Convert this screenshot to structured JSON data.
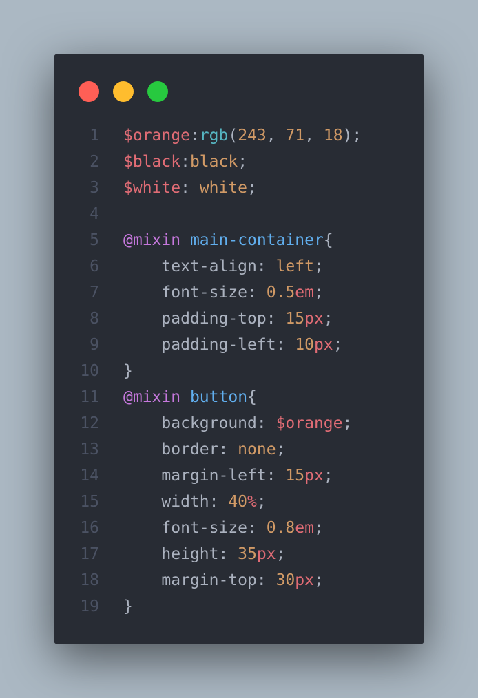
{
  "window": {
    "controls": [
      {
        "name": "close",
        "color": "#ff5f56"
      },
      {
        "name": "minimize",
        "color": "#ffbd2e"
      },
      {
        "name": "maximize",
        "color": "#27c93f"
      }
    ]
  },
  "code": {
    "language": "scss",
    "lines": [
      {
        "number": "1",
        "tokens": [
          {
            "text": "$orange",
            "type": "var"
          },
          {
            "text": ":",
            "type": "p"
          },
          {
            "text": "rgb",
            "type": "fn"
          },
          {
            "text": "(",
            "type": "p"
          },
          {
            "text": "243",
            "type": "num"
          },
          {
            "text": ", ",
            "type": "p"
          },
          {
            "text": "71",
            "type": "num"
          },
          {
            "text": ", ",
            "type": "p"
          },
          {
            "text": "18",
            "type": "num"
          },
          {
            "text": ");",
            "type": "p"
          }
        ]
      },
      {
        "number": "2",
        "tokens": [
          {
            "text": "$black",
            "type": "var"
          },
          {
            "text": ":",
            "type": "p"
          },
          {
            "text": "black",
            "type": "num"
          },
          {
            "text": ";",
            "type": "p"
          }
        ]
      },
      {
        "number": "3",
        "tokens": [
          {
            "text": "$white",
            "type": "var"
          },
          {
            "text": ": ",
            "type": "p"
          },
          {
            "text": "white",
            "type": "num"
          },
          {
            "text": ";",
            "type": "p"
          }
        ]
      },
      {
        "number": "4",
        "tokens": []
      },
      {
        "number": "5",
        "tokens": [
          {
            "text": "@mixin",
            "type": "kw"
          },
          {
            "text": " ",
            "type": "p"
          },
          {
            "text": "main-container",
            "type": "name"
          },
          {
            "text": "{",
            "type": "p"
          }
        ]
      },
      {
        "number": "6",
        "tokens": [
          {
            "text": "    text-align: ",
            "type": "p"
          },
          {
            "text": "left",
            "type": "num"
          },
          {
            "text": ";",
            "type": "p"
          }
        ]
      },
      {
        "number": "7",
        "tokens": [
          {
            "text": "    font-size: ",
            "type": "p"
          },
          {
            "text": "0.5",
            "type": "num"
          },
          {
            "text": "em",
            "type": "unit"
          },
          {
            "text": ";",
            "type": "p"
          }
        ]
      },
      {
        "number": "8",
        "tokens": [
          {
            "text": "    padding-top: ",
            "type": "p"
          },
          {
            "text": "15",
            "type": "num"
          },
          {
            "text": "px",
            "type": "unit"
          },
          {
            "text": ";",
            "type": "p"
          }
        ]
      },
      {
        "number": "9",
        "tokens": [
          {
            "text": "    padding-left: ",
            "type": "p"
          },
          {
            "text": "10",
            "type": "num"
          },
          {
            "text": "px",
            "type": "unit"
          },
          {
            "text": ";",
            "type": "p"
          }
        ]
      },
      {
        "number": "10",
        "tokens": [
          {
            "text": "}",
            "type": "p"
          }
        ]
      },
      {
        "number": "11",
        "tokens": [
          {
            "text": "@mixin",
            "type": "kw"
          },
          {
            "text": " ",
            "type": "p"
          },
          {
            "text": "button",
            "type": "name"
          },
          {
            "text": "{",
            "type": "p"
          }
        ]
      },
      {
        "number": "12",
        "tokens": [
          {
            "text": "    background: ",
            "type": "p"
          },
          {
            "text": "$orange",
            "type": "var"
          },
          {
            "text": ";",
            "type": "p"
          }
        ]
      },
      {
        "number": "13",
        "tokens": [
          {
            "text": "    border: ",
            "type": "p"
          },
          {
            "text": "none",
            "type": "num"
          },
          {
            "text": ";",
            "type": "p"
          }
        ]
      },
      {
        "number": "14",
        "tokens": [
          {
            "text": "    margin-left: ",
            "type": "p"
          },
          {
            "text": "15",
            "type": "num"
          },
          {
            "text": "px",
            "type": "unit"
          },
          {
            "text": ";",
            "type": "p"
          }
        ]
      },
      {
        "number": "15",
        "tokens": [
          {
            "text": "    width: ",
            "type": "p"
          },
          {
            "text": "40",
            "type": "num"
          },
          {
            "text": "%",
            "type": "unit"
          },
          {
            "text": ";",
            "type": "p"
          }
        ]
      },
      {
        "number": "16",
        "tokens": [
          {
            "text": "    font-size: ",
            "type": "p"
          },
          {
            "text": "0.8",
            "type": "num"
          },
          {
            "text": "em",
            "type": "unit"
          },
          {
            "text": ";",
            "type": "p"
          }
        ]
      },
      {
        "number": "17",
        "tokens": [
          {
            "text": "    height: ",
            "type": "p"
          },
          {
            "text": "35",
            "type": "num"
          },
          {
            "text": "px",
            "type": "unit"
          },
          {
            "text": ";",
            "type": "p"
          }
        ]
      },
      {
        "number": "18",
        "tokens": [
          {
            "text": "    margin-top: ",
            "type": "p"
          },
          {
            "text": "30",
            "type": "num"
          },
          {
            "text": "px",
            "type": "unit"
          },
          {
            "text": ";",
            "type": "p"
          }
        ]
      },
      {
        "number": "19",
        "tokens": [
          {
            "text": "}",
            "type": "p"
          }
        ]
      }
    ]
  }
}
